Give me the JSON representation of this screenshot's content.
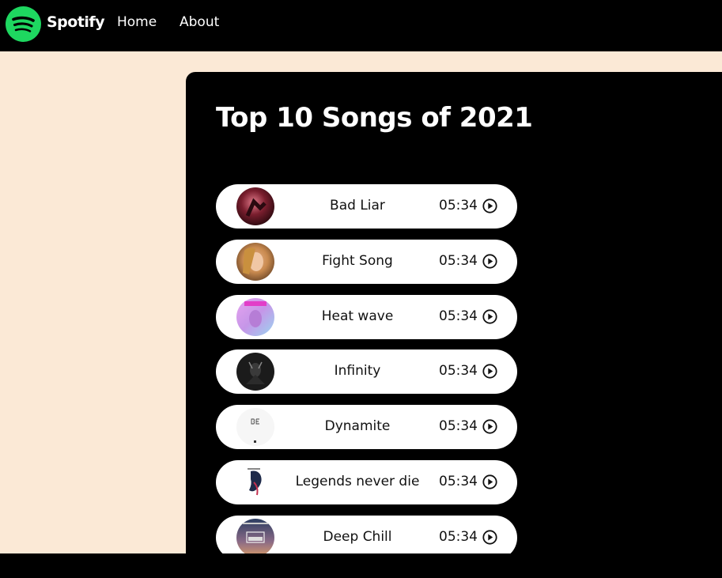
{
  "nav": {
    "brand": "Spotify",
    "links": [
      "Home",
      "About"
    ],
    "logo_icon": "spotify-logo-icon",
    "logo_color": "#1ed760"
  },
  "page": {
    "background_color": "#fbe9d6",
    "panel_color": "#000000"
  },
  "main": {
    "title": "Top 10 Songs of 2021",
    "songs": [
      {
        "title": "Bad Liar",
        "duration": "05:34"
      },
      {
        "title": "Fight Song",
        "duration": "05:34"
      },
      {
        "title": "Heat wave",
        "duration": "05:34"
      },
      {
        "title": "Infinity",
        "duration": "05:34"
      },
      {
        "title": "Dynamite",
        "duration": "05:34"
      },
      {
        "title": "Legends never die",
        "duration": "05:34"
      },
      {
        "title": "Deep Chill",
        "duration": "05:34"
      }
    ],
    "play_icon": "play-circle-icon"
  }
}
